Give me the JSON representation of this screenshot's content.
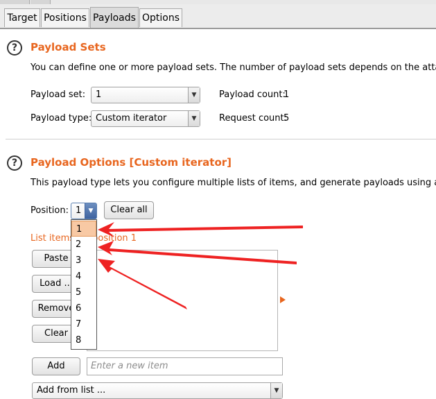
{
  "tabs": [
    {
      "label": "Target"
    },
    {
      "label": "Positions"
    },
    {
      "label": "Payloads"
    },
    {
      "label": "Options"
    }
  ],
  "active_tab": "Payloads",
  "payload_sets": {
    "title": "Payload Sets",
    "description": "You can define one or more payload sets. The number of payload sets depends on the attack type de",
    "payload_set_label": "Payload set:",
    "payload_set_value": "1",
    "payload_type_label": "Payload type:",
    "payload_type_value": "Custom iterator",
    "payload_count_label": "Payload count:",
    "payload_count_value": "1",
    "request_count_label": "Request count:",
    "request_count_value": "5"
  },
  "payload_options": {
    "title": "Payload Options [Custom iterator]",
    "description": "This payload type lets you configure multiple lists of items, and generate payloads using all permutati",
    "position_label": "Position:",
    "position_value": "1",
    "clear_all_label": "Clear all",
    "list_items_label": "List items for position 1",
    "buttons": {
      "paste": "Paste",
      "load": "Load ...",
      "remove": "Remove",
      "clear": "Clear",
      "add": "Add"
    },
    "new_item_placeholder": "Enter a new item",
    "add_from_list_label": "Add from list ..."
  },
  "position_dropdown": {
    "options": [
      "1",
      "2",
      "3",
      "4",
      "5",
      "6",
      "7",
      "8"
    ],
    "selected": "1"
  },
  "colors": {
    "heading": "#e8661f",
    "annotation_arrow": "#ee2222",
    "selection": "#f8c9a4"
  }
}
